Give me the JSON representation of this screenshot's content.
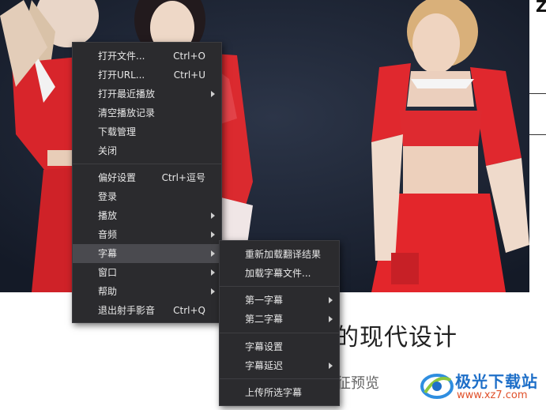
{
  "main_menu": {
    "items": [
      {
        "label": "打开文件...",
        "shortcut": "Ctrl+O"
      },
      {
        "label": "打开URL...",
        "shortcut": "Ctrl+U"
      },
      {
        "label": "打开最近播放",
        "submenu": true
      },
      {
        "label": "清空播放记录"
      },
      {
        "label": "下载管理"
      },
      {
        "label": "关闭"
      },
      {
        "label": "偏好设置",
        "shortcut": "Ctrl+逗号"
      },
      {
        "label": "登录"
      },
      {
        "label": "播放",
        "submenu": true
      },
      {
        "label": "音频",
        "submenu": true
      },
      {
        "label": "字幕",
        "submenu": true,
        "active": true
      },
      {
        "label": "窗口",
        "submenu": true
      },
      {
        "label": "帮助",
        "submenu": true
      },
      {
        "label": "退出射手影音",
        "shortcut": "Ctrl+Q"
      }
    ]
  },
  "subtitle_menu": {
    "items": [
      {
        "label": "重新加载翻译结果"
      },
      {
        "label": "加载字幕文件..."
      },
      {
        "label": "第一字幕",
        "submenu": true
      },
      {
        "label": "第二字幕",
        "submenu": true
      },
      {
        "label": "字幕设置"
      },
      {
        "label": "字幕延迟",
        "submenu": true
      },
      {
        "label": "上传所选字幕"
      }
    ]
  },
  "background": {
    "title_fragment": "的现代设计",
    "sub_fragment": "征预览",
    "edge_glyph": "Z"
  },
  "watermark": {
    "brand": "极光下载站",
    "url": "www.xz7.com"
  },
  "colors": {
    "menu_bg": "#2b2b2e",
    "menu_active": "#4a4a4f",
    "menu_text": "#e8e8e8",
    "costume_red": "#e0282e",
    "brand_blue": "#1e6fc8",
    "url_orange": "#e0502a"
  }
}
